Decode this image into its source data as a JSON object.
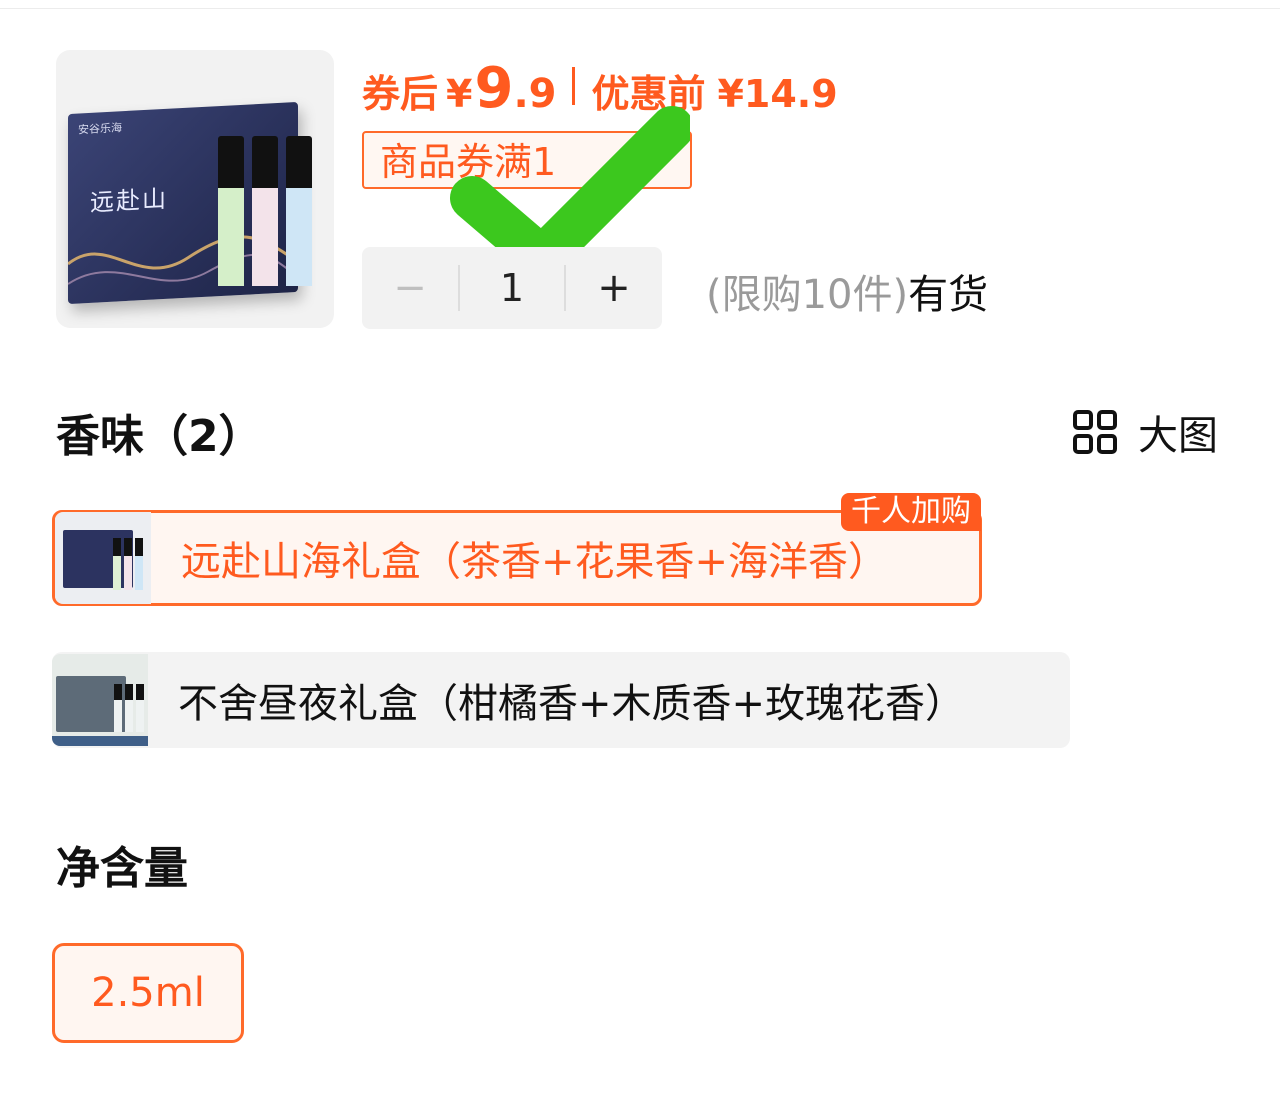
{
  "price": {
    "after_coupon_label": "券后",
    "currency": "¥",
    "after_coupon_int": "9",
    "after_coupon_dec": ".9",
    "before_label": "优惠前",
    "before_value": "¥14.9"
  },
  "coupon": {
    "text": "商品券满1"
  },
  "thumbnail": {
    "brand": "安谷乐海",
    "calligraphy": "远赴山"
  },
  "stepper": {
    "minus": "−",
    "quantity": "1",
    "plus": "+"
  },
  "stock": {
    "limit": "(限购10件)",
    "status": "有货"
  },
  "scent": {
    "heading": "香味（2）",
    "big_view_label": "大图",
    "options": [
      {
        "label": "远赴山海礼盒（茶香+花果香+海洋香）",
        "badge": "千人加购",
        "selected": true
      },
      {
        "label": "不舍昼夜礼盒（柑橘香+木质香+玫瑰花香）",
        "selected": false
      }
    ]
  },
  "volume": {
    "heading": "净含量",
    "options": [
      {
        "label": "2.5ml",
        "selected": true
      }
    ]
  },
  "colors": {
    "accent": "#ff5a1f",
    "check": "#3cc81e"
  },
  "icons": [
    "grid-icon",
    "check-icon"
  ]
}
